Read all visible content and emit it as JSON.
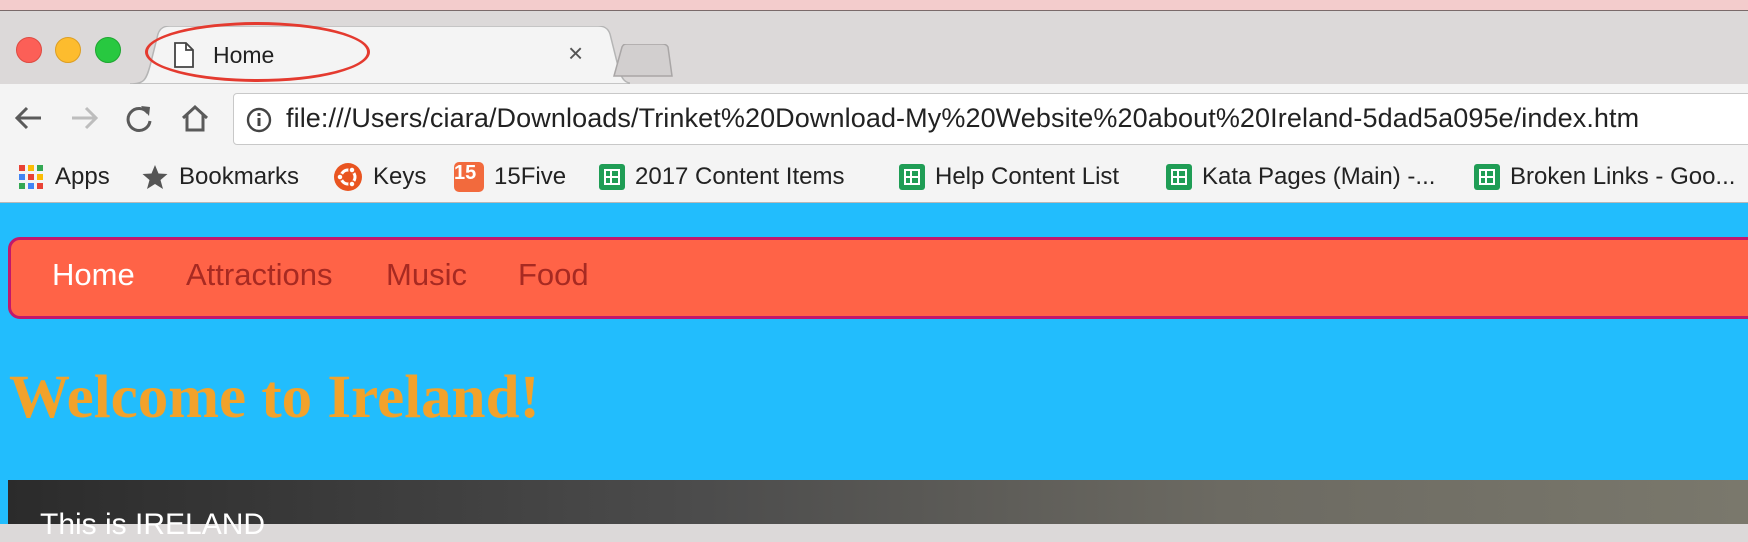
{
  "browser": {
    "tab": {
      "title": "Home",
      "close_glyph": "×"
    },
    "address_bar": {
      "url": "file:///Users/ciara/Downloads/Trinket%20Download-My%20Website%20about%20Ireland-5dad5a095e/index.htm"
    },
    "bookmarks": [
      {
        "label": "Apps",
        "icon": "apps-grid-icon"
      },
      {
        "label": "Bookmarks",
        "icon": "star-icon"
      },
      {
        "label": "Keys",
        "icon": "ubuntu-icon"
      },
      {
        "label": "15Five",
        "icon": "fifteen-five-icon",
        "icon_text": "15"
      },
      {
        "label": "2017 Content Items",
        "icon": "sheets-icon"
      },
      {
        "label": "Help Content List",
        "icon": "sheets-icon"
      },
      {
        "label": "Kata Pages (Main) -...",
        "icon": "sheets-icon"
      },
      {
        "label": "Broken Links - Goo...",
        "icon": "sheets-icon"
      }
    ]
  },
  "page": {
    "nav": [
      {
        "label": "Home",
        "active": true
      },
      {
        "label": "Attractions",
        "active": false
      },
      {
        "label": "Music",
        "active": false
      },
      {
        "label": "Food",
        "active": false
      }
    ],
    "heading": "Welcome to Ireland!",
    "hero_text": "This is IRELAND"
  },
  "colors": {
    "page_background": "#22bdfd",
    "navbar_background": "#ff6347",
    "navbar_border": "#c2186b",
    "nav_active": "#ffffff",
    "nav_inactive": "#a72a22",
    "heading": "#f2a22b",
    "annotation": "#e43a2f"
  }
}
